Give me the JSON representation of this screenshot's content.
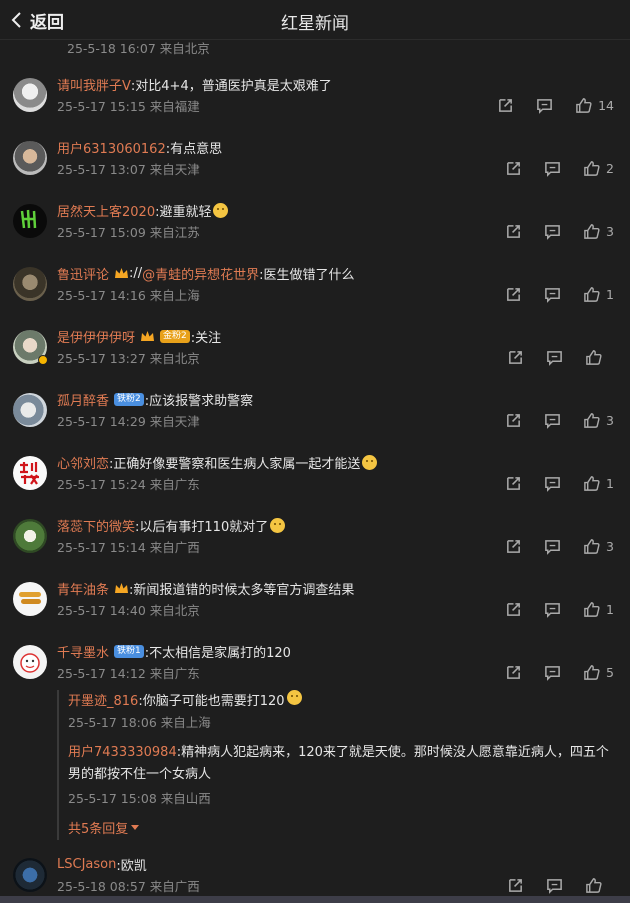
{
  "header": {
    "back_label": "返回",
    "title": "红星新闻"
  },
  "partial_meta": "25-5-18 16:07 来自北京",
  "comments": [
    {
      "name": "请叫我胖子V",
      "text": ":对比4+4，普通医护真是太艰难了",
      "meta": "25-5-17 15:15 来自福建",
      "likes": "14"
    },
    {
      "name": "用户6313060162",
      "text": ":有点意思",
      "meta": "25-5-17 13:07 来自天津",
      "likes": "2"
    },
    {
      "name": "居然天上客2020",
      "text": ":避重就轻",
      "meta": "25-5-17 15:09 来自江苏",
      "likes": "3"
    },
    {
      "name": "鲁迅评论",
      "text_pre": " ://",
      "mention": "@青蛙的异想花世界",
      "text": ":医生做错了什么",
      "meta": "25-5-17 14:16 来自上海",
      "likes": "1"
    },
    {
      "name": "是伊伊伊伊呀",
      "badge": "金粉2",
      "text": ":关注",
      "meta": "25-5-17 13:27 来自北京",
      "likes": ""
    },
    {
      "name": "孤月醉香",
      "badge": "铁粉2",
      "text": ":应该报警求助警察",
      "meta": "25-5-17 14:29 来自天津",
      "likes": "3"
    },
    {
      "name": "心邻刘恋",
      "text": ":正确好像要警察和医生病人家属一起才能送",
      "meta": "25-5-17 15:24 来自广东",
      "likes": "1"
    },
    {
      "name": "落蕊下的微笑",
      "text": ":以后有事打110就对了",
      "meta": "25-5-17 15:14 来自广西",
      "likes": "3"
    },
    {
      "name": "青年油条",
      "text": " :新闻报道错的时候太多等官方调查结果",
      "meta": "25-5-17 14:40 来自北京",
      "likes": "1"
    },
    {
      "name": "千寻墨水",
      "badge": "铁粉1",
      "text": ":不太相信是家属打的120",
      "meta": "25-5-17 14:12 来自广东",
      "likes": "5"
    },
    {
      "name": "LSCJason",
      "text": ":欧凯",
      "meta": "25-5-18 08:57 来自广西",
      "likes": ""
    }
  ],
  "replies": [
    {
      "name": "开墨迹_816",
      "text": ":你脑子可能也需要打120",
      "meta": "25-5-17 18:06 来自上海"
    },
    {
      "name": "用户7433330984",
      "text": ":精神病人犯起病来，120来了就是天使。那时候没人愿意靠近病人，四五个男的都按不住一个女病人",
      "meta": "25-5-17 15:08 来自山西"
    }
  ],
  "more_replies": "共5条回复",
  "colors": {
    "background": "#1e1e1e",
    "username": "#e07b53",
    "meta": "#8a8a8a"
  },
  "icons": [
    "back-chevron-icon",
    "share-icon",
    "comment-icon",
    "like-icon"
  ]
}
